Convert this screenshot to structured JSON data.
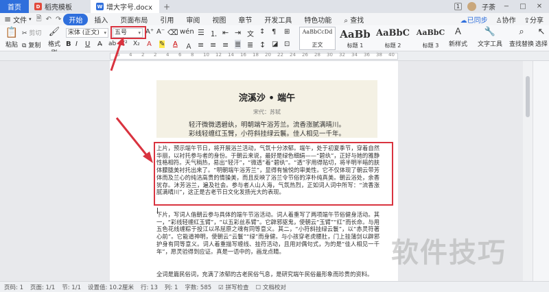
{
  "titlebar": {
    "home_tab": "首页",
    "tabs": [
      {
        "label": "稻壳模板",
        "badge": "D"
      },
      {
        "label": "增大字号.docx",
        "badge": "W"
      }
    ],
    "plus": "+",
    "badge_num": "1",
    "user": "子荼",
    "min": "−",
    "max": "□",
    "close": "✕"
  },
  "menubar": {
    "file": "文件",
    "items": [
      "开始",
      "插入",
      "页面布局",
      "引用",
      "审阅",
      "视图",
      "章节",
      "开发工具",
      "特色功能"
    ],
    "active": "开始",
    "search": "查找",
    "right": [
      "已同步",
      "协作",
      "分享"
    ]
  },
  "ribbon": {
    "paste": "粘贴",
    "cut": "剪切",
    "copy": "复制",
    "format_painter": "格式刷",
    "font_name": "宋体 (正文)",
    "font_size": "五号",
    "styles": [
      {
        "sample": "AaBbCcDd",
        "label": "正文"
      },
      {
        "sample": "AaBb",
        "label": "标题 1"
      },
      {
        "sample": "AaBbC",
        "label": "标题 2"
      },
      {
        "sample": "AaBbC",
        "label": "标题 3"
      }
    ],
    "new_style": "新样式",
    "text_tools": "文字工具",
    "find_replace": "查找替换",
    "select": "选择"
  },
  "ruler": {
    "numbers": [
      "6",
      "4",
      "2",
      "2",
      "4",
      "6",
      "8",
      "10",
      "12",
      "14",
      "16",
      "18",
      "20",
      "22",
      "24",
      "26",
      "28",
      "30",
      "32",
      "34",
      "36",
      "38",
      "40"
    ]
  },
  "document": {
    "poem_title": "浣溪沙 • 端午",
    "poem_author": "宋代：苏轼",
    "poem_lines": [
      "轻汗微微透碧纨，明朝端午浴芳兰。流香涨腻满晴川。",
      "彩线轻缠红玉臂，小符斜挂绿云鬟。佳人相见一千年。"
    ],
    "para1": "上片，预示端午节日，将开展浴兰活动，气氛十分浓郁。端午，处于初夏季节，穿着自然华丽，以衬托参与者的身份。于朝云来说，最好是绿色细绢——“碧纨”，正好与她的雅静性格相符。天气稍热，易出“轻汗”，“微透”着“碧纨”。“透”字用得贴切，将半明半暗的肤体朦胧美衬托出来了。“明朝端午浴芳兰”，显得有愉悦的审美性。它不仅体现了朝云带芳体而及兰心的纯洁高贵的情操美，而且反映了浴兰令节俗的淳朴纯真美。朝云浴处，余香犹存。沐芳浴兰，遍及社会。参与者人山人海，气氛热烈，正如词人词中所写：“流香涨腻满晴川”，这正是古老节日文化发扬光大的表现。",
    "para2": "下片，写词人偕朝云参与具体的端午节浴活动。词人着重写了两项端午节俗健身活动。其一，“彩线轻缠红玉臂”，“以五彩丝系臂”。它辟邪驱鬼，使朝云“玉臂”“红”而长命。与用五色花线缠粽于投江以吊屈原之魂有同等意义。其二，“小符斜挂绿云鬟”，以“赤灵符著心前”。它能道神明，使朝云“云鬟”“绿”而身健。与小孩穿老虎腰肚，门上挂蒲剑以辟邪护身有同等意义。词人着重描写缠线、挂符活动，且用对偶句式，为的是“佳人相见一千年”，愿灵验得到应证。真是一语中的，画龙点睛。",
    "para3": "全词是篇民俗词，充满了浓郁的古老民俗气息，是研究端午民俗最形象而珍贵的资料。"
  },
  "watermark": "软件技巧",
  "status": {
    "page": "页码: 1",
    "pages": "页面: 1/1",
    "section": "节: 1/1",
    "setting": "设置值: 10.2厘米",
    "row": "行: 13",
    "col": "列: 1",
    "words": "字数: 585",
    "spell": "拼写检查",
    "proof": "文档校对"
  },
  "colors": {
    "accent": "#2f6fdc",
    "highlight": "#d9333f"
  }
}
